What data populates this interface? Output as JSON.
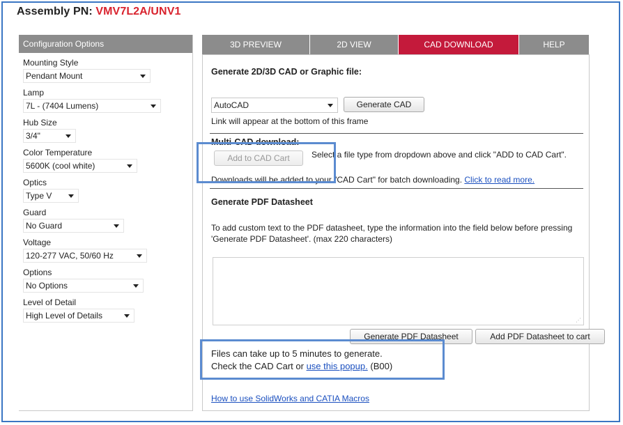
{
  "header": {
    "label": "Assembly PN:",
    "part_number": "VMV7L2A/UNV1"
  },
  "config": {
    "title": "Configuration Options",
    "options": [
      {
        "label": "Mounting Style",
        "value": "Pendant Mount"
      },
      {
        "label": "Lamp",
        "value": "7L - (7404 Lumens)"
      },
      {
        "label": "Hub Size",
        "value": "3/4\""
      },
      {
        "label": "Color Temperature",
        "value": "5600K (cool white)"
      },
      {
        "label": "Optics",
        "value": "Type V"
      },
      {
        "label": "Guard",
        "value": "No Guard"
      },
      {
        "label": "Voltage",
        "value": "120-277 VAC, 50/60 Hz"
      },
      {
        "label": "Options",
        "value": "No Options"
      },
      {
        "label": "Level of Detail",
        "value": "High Level of Details"
      }
    ]
  },
  "tabs": [
    {
      "label": "3D PREVIEW",
      "active": false
    },
    {
      "label": "2D VIEW",
      "active": false
    },
    {
      "label": "CAD DOWNLOAD",
      "active": true
    },
    {
      "label": "HELP",
      "active": false
    }
  ],
  "cad": {
    "heading": "Generate 2D/3D CAD or Graphic file:",
    "format_value": "AutoCAD",
    "generate_label": "Generate CAD",
    "link_note": "Link will appear at the bottom of this frame",
    "multi_heading": "Multi-CAD download:",
    "add_cart_label": "Add to CAD Cart",
    "select_instruction": "Select a file type from dropdown above and click \"ADD to CAD Cart\".",
    "downloads_note": "Downloads will be added to your \"CAD Cart\" for batch downloading.",
    "read_more": "Click to read more."
  },
  "pdf": {
    "heading": "Generate PDF Datasheet",
    "instructions": "To add custom text to the PDF datasheet, type the information into the field below before pressing 'Generate PDF Datasheet'. (max 220 characters)",
    "custom_text": "",
    "generate_label": "Generate PDF Datasheet",
    "add_cart_label": "Add PDF Datasheet to cart"
  },
  "notice": {
    "line1": "Files can take up to 5 minutes to generate.",
    "line2_prefix": "Check the CAD Cart or",
    "popup_link": "use this popup.",
    "code": "(B00)"
  },
  "macros_link": "How to use SolidWorks and CATIA Macros",
  "colors": {
    "accent_red": "#c41a3b",
    "tab_gray": "#8c8c8c",
    "highlight_blue": "#5b8bd0",
    "link_blue": "#1a4fbf"
  }
}
